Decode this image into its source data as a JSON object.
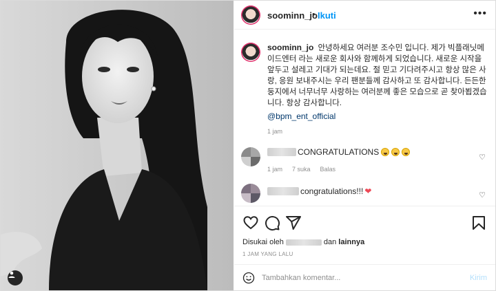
{
  "post": {
    "username": "soominn_jo",
    "dot": "•",
    "follow_label": "Ikuti",
    "more_label": "•••"
  },
  "caption": {
    "username": "soominn_jo",
    "text": "안녕하세요 여러분 조수민 입니다. 제가 빅플래닛메이드엔터 라는 새로운 회사와 함께하게 되었습니다. 새로운 시작을 앞두고 설레고 기대가 되는데요. 절 믿고 기다려주시고 항상 많은 사랑, 응원 보내주시는 우리 팬분들께 감사하고 또 감사합니다. 든든한 둥지에서 너무너무 사랑하는 여러분께 좋은 모습으로 곧 찾아뵙겠습니다. 항상 감사합니다.",
    "mention": "@bpm_ent_official",
    "time": "1 jam"
  },
  "comments": [
    {
      "text": "CONGRATULATIONS",
      "meta_time": "1 jam",
      "meta_likes": "7 suka",
      "meta_reply": "Balas",
      "emoji_names": [
        "crying-face-icon",
        "crying-face-icon",
        "crying-face-icon"
      ]
    },
    {
      "text": "congratulations!!!",
      "emoji_names": [
        "red-heart-icon"
      ]
    }
  ],
  "likes": {
    "prefix": "Disukai oleh",
    "middle": "dan",
    "suffix": "lainnya"
  },
  "post_time": "1 JAM YANG LALU",
  "comment_box": {
    "placeholder": "Tambahkan komentar...",
    "post_label": "Kirim"
  },
  "colors": {
    "accent": "#0095f6",
    "post_disabled": "#b2dffc",
    "secondary_text": "#8e8e8e",
    "heart": "#ed4956"
  }
}
